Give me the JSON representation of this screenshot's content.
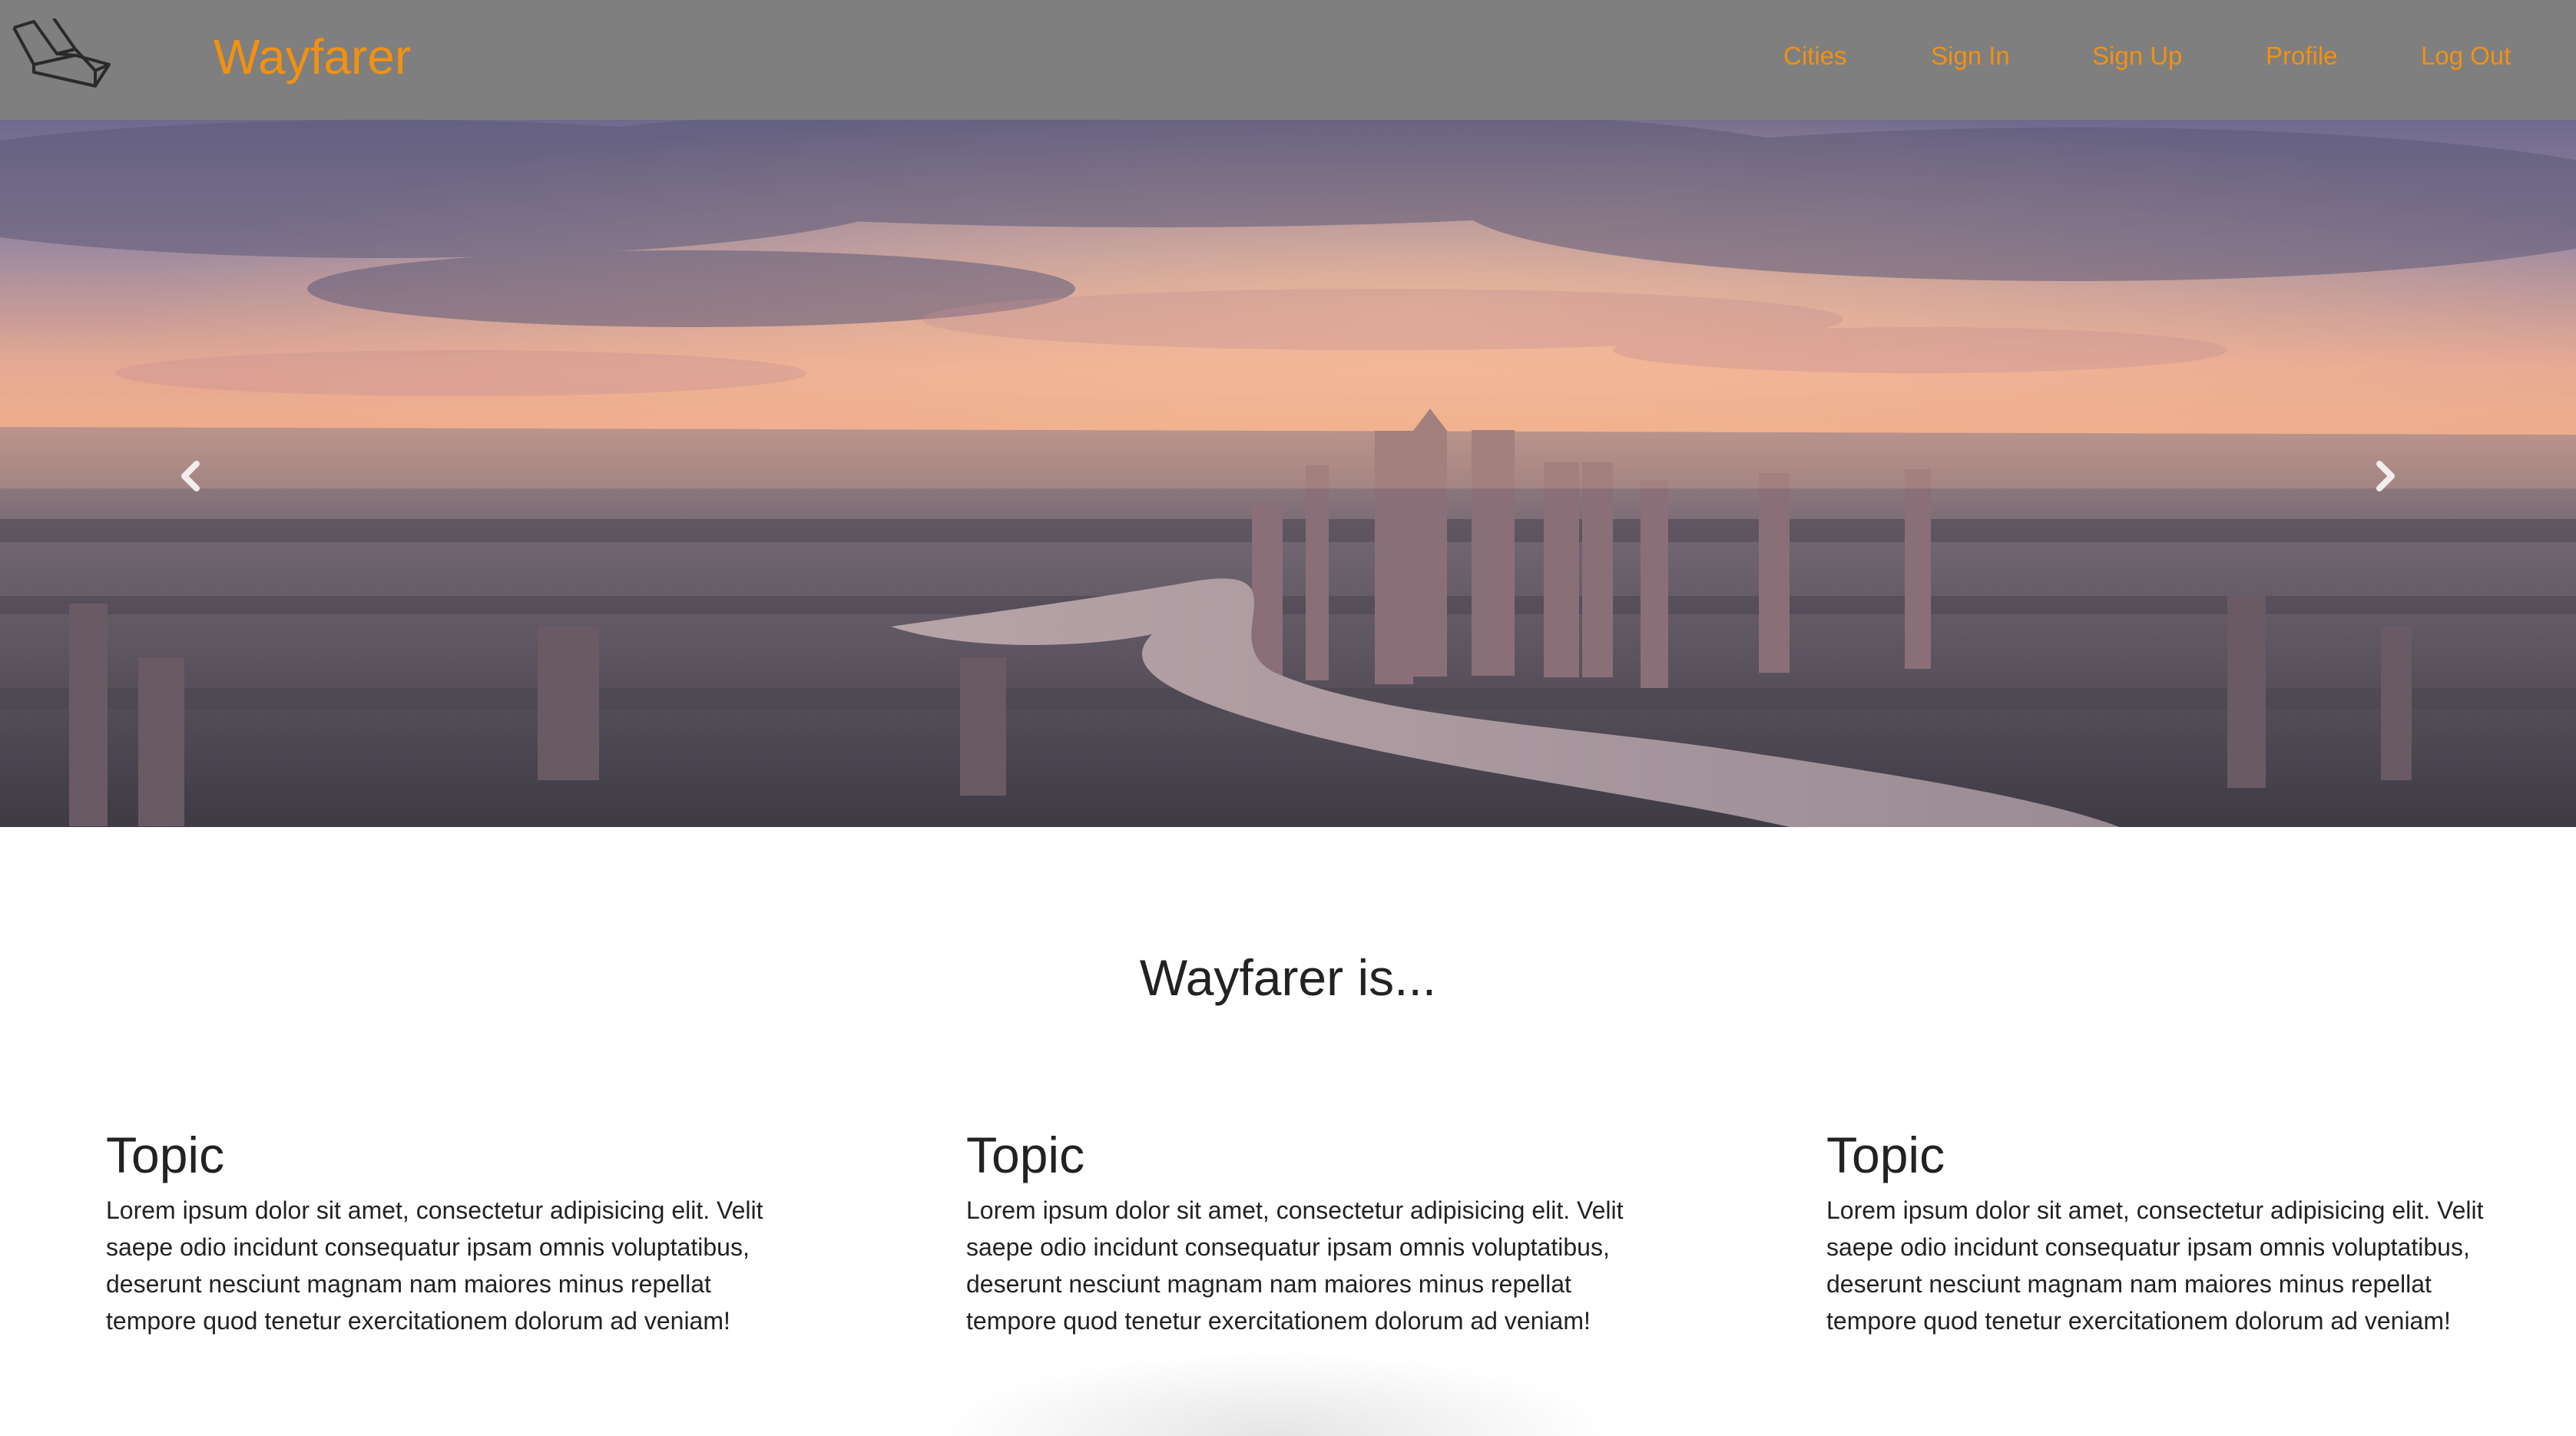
{
  "navbar": {
    "brand": "Wayfarer",
    "logo_icon": "laravel-logo-icon",
    "links": [
      "Cities",
      "Sign In",
      "Sign Up",
      "Profile",
      "Log Out"
    ],
    "accent_color": "#f29111",
    "background_color": "#7f7f7f"
  },
  "hero": {
    "image_subject": "city skyline at sunset with river",
    "prev_icon": "chevron-left-icon",
    "next_icon": "chevron-right-icon"
  },
  "main": {
    "heading": "Wayfarer is...",
    "topics": [
      {
        "title": "Topic",
        "body": "Lorem ipsum dolor sit amet, consectetur adipisicing elit. Velit saepe odio incidunt consequatur ipsam omnis voluptatibus, deserunt nesciunt magnam nam maiores minus repellat tempore quod tenetur exercitationem dolorum ad veniam!"
      },
      {
        "title": "Topic",
        "body": "Lorem ipsum dolor sit amet, consectetur adipisicing elit. Velit saepe odio incidunt consequatur ipsam omnis voluptatibus, deserunt nesciunt magnam nam maiores minus repellat tempore quod tenetur exercitationem dolorum ad veniam!"
      },
      {
        "title": "Topic",
        "body": "Lorem ipsum dolor sit amet, consectetur adipisicing elit. Velit saepe odio incidunt consequatur ipsam omnis voluptatibus, deserunt nesciunt magnam nam maiores minus repellat tempore quod tenetur exercitationem dolorum ad veniam!"
      }
    ]
  }
}
